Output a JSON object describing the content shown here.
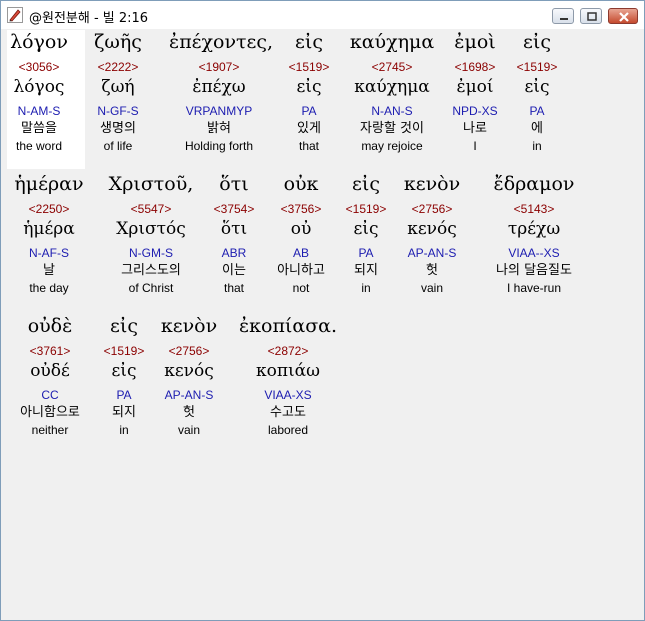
{
  "window": {
    "title": "@원전분해 - 빌 2:16",
    "app_icon": "pen-icon",
    "buttons": {
      "minimize": "minimize-icon",
      "maximize": "maximize-icon",
      "close": "close-icon"
    }
  },
  "colors": {
    "strong": "#8b0000",
    "parse": "#1c1cb0",
    "text": "#000000",
    "highlight": "#ffffff",
    "background": "#f0f0f0"
  },
  "lines": [
    {
      "words": [
        {
          "greek": "λόγον",
          "strong": "<3056>",
          "lemma": "λόγος",
          "parse": "N-AM-S",
          "korean": "말씀을",
          "english": "the word"
        },
        {
          "greek": "ζωῆς",
          "strong": "<2222>",
          "lemma": "ζωή",
          "parse": "N-GF-S",
          "korean": "생명의",
          "english": "of life"
        },
        {
          "greek": "ἐπέχοντες,",
          "strong": "<1907>",
          "lemma": "ἐπέχω",
          "parse": "VRPANMYP",
          "korean": "밝혀",
          "english": "Holding forth"
        },
        {
          "greek": "εἰς",
          "strong": "<1519>",
          "lemma": "εἰς",
          "parse": "PA",
          "korean": "있게",
          "english": "that"
        },
        {
          "greek": "καύχημα",
          "strong": "<2745>",
          "lemma": "καύχημα",
          "parse": "N-AN-S",
          "korean": "자랑할 것이",
          "english": "may rejoice"
        },
        {
          "greek": "ἐμοὶ",
          "strong": "<1698>",
          "lemma": "ἐμοί",
          "parse": "NPD-XS",
          "korean": "나로",
          "english": "I"
        },
        {
          "greek": "εἰς",
          "strong": "<1519>",
          "lemma": "εἰς",
          "parse": "PA",
          "korean": "에",
          "english": "in"
        }
      ]
    },
    {
      "words": [
        {
          "greek": "ἡμέραν",
          "strong": "<2250>",
          "lemma": "ἡμέρα",
          "parse": "N-AF-S",
          "korean": "날",
          "english": "the day"
        },
        {
          "greek": "Χριστοῦ,",
          "strong": "<5547>",
          "lemma": "Χριστός",
          "parse": "N-GM-S",
          "korean": "그리스도의",
          "english": "of Christ"
        },
        {
          "greek": "ὅτι",
          "strong": "<3754>",
          "lemma": "ὅτι",
          "parse": "ABR",
          "korean": "이는",
          "english": "that"
        },
        {
          "greek": "οὐκ",
          "strong": "<3756>",
          "lemma": "οὐ",
          "parse": "AB",
          "korean": "아니하고",
          "english": "not"
        },
        {
          "greek": "εἰς",
          "strong": "<1519>",
          "lemma": "εἰς",
          "parse": "PA",
          "korean": "되지",
          "english": "in"
        },
        {
          "greek": "κενὸν",
          "strong": "<2756>",
          "lemma": "κενός",
          "parse": "AP-AN-S",
          "korean": "헛",
          "english": "vain"
        },
        {
          "greek": "ἔδραμον",
          "strong": "<5143>",
          "lemma": "τρέχω",
          "parse": "VIAA--XS",
          "korean": "나의 달음질도",
          "english": "I have-run"
        }
      ]
    },
    {
      "words": [
        {
          "greek": "οὐδὲ",
          "strong": "<3761>",
          "lemma": "οὐδέ",
          "parse": "CC",
          "korean": "아니함으로",
          "english": "neither"
        },
        {
          "greek": "εἰς",
          "strong": "<1519>",
          "lemma": "εἰς",
          "parse": "PA",
          "korean": "되지",
          "english": "in"
        },
        {
          "greek": "κενὸν",
          "strong": "<2756>",
          "lemma": "κενός",
          "parse": "AP-AN-S",
          "korean": "헛",
          "english": "vain"
        },
        {
          "greek": "ἐκοπίασα.",
          "strong": "<2872>",
          "lemma": "κοπιάω",
          "parse": "VIAA-XS",
          "korean": "수고도",
          "english": "labored"
        }
      ]
    }
  ]
}
